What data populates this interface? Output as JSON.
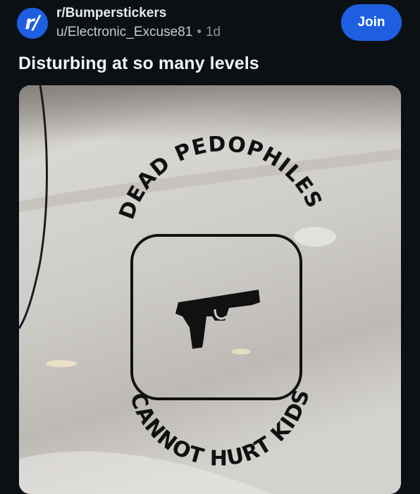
{
  "header": {
    "subreddit_icon_text": "r/",
    "subreddit_icon": "subreddit-avatar-icon",
    "subreddit": "r/Bumperstickers",
    "user": "u/Electronic_Excuse81",
    "separator": "•",
    "age": "1d",
    "join_label": "Join"
  },
  "post": {
    "title": "Disturbing at so many levels",
    "image": {
      "sticker_top_text": "DEAD PEDOPHILES",
      "sticker_bottom_text": "CANNOT HURT KIDS",
      "sticker_icon": "handgun-icon"
    }
  },
  "colors": {
    "background": "#0b1015",
    "accent": "#1d5fe0",
    "text_primary": "#f2f4f5",
    "text_secondary": "#8a9196"
  }
}
